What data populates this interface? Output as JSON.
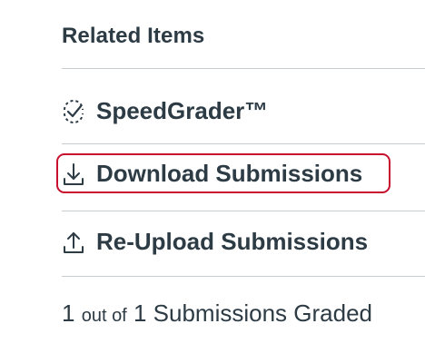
{
  "related": {
    "heading": "Related Items",
    "speedgrader": {
      "label": "SpeedGrader™",
      "icon": "speedgrader-icon"
    },
    "download": {
      "label": "Download Submissions",
      "icon": "download-icon"
    },
    "reupload": {
      "label": "Re-Upload Submissions",
      "icon": "upload-icon"
    }
  },
  "status": {
    "graded": "1",
    "out_of": "out of",
    "total_text": "1 Submissions Graded"
  },
  "colors": {
    "text": "#2d3b45",
    "divider": "#c7cdd1",
    "highlight": "#c8102e"
  }
}
